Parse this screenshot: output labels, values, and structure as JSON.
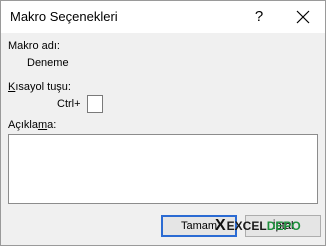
{
  "window": {
    "title": "Makro Seçenekleri",
    "help_label": "?"
  },
  "macro_name": {
    "label": "Makro adı:",
    "value": "Deneme"
  },
  "shortcut": {
    "label_accel": "K",
    "label_rest": "ısayol tuşu:",
    "prefix": "Ctrl+",
    "value": ""
  },
  "description": {
    "label_pre": "Açıkla",
    "label_accel": "m",
    "label_post": "a:",
    "value": ""
  },
  "buttons": {
    "ok": "Tamam",
    "cancel": "İptal"
  },
  "watermark": {
    "x": "X",
    "excel": "EXCEL",
    "depo": "DEPO"
  },
  "colors": {
    "ok_focus_border": "#2b6bd3",
    "watermark_green": "#1d8f3c"
  }
}
